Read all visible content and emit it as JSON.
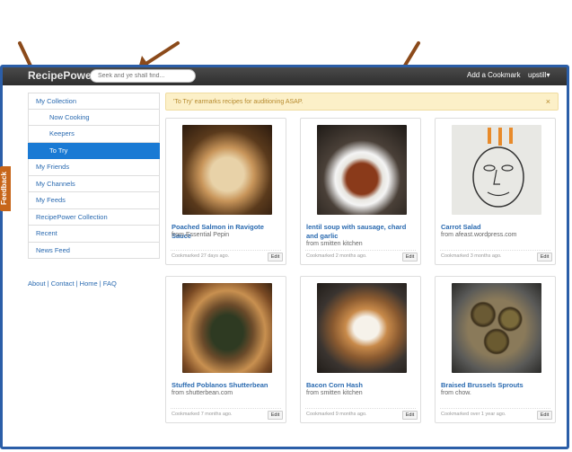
{
  "navbar": {
    "brand": "RecipePower",
    "search_placeholder": "Seek and ye shall find...",
    "add_cookmark": "Add a Cookmark",
    "user_menu": "upstill"
  },
  "feedback_tab": "Feedback",
  "sidebar": {
    "items": [
      {
        "label": "My Collection",
        "level": 0,
        "active": false
      },
      {
        "label": "Now Cooking",
        "level": 1,
        "active": false
      },
      {
        "label": "Keepers",
        "level": 1,
        "active": false
      },
      {
        "label": "To Try",
        "level": 1,
        "active": true
      },
      {
        "label": "My Friends",
        "level": 0,
        "active": false
      },
      {
        "label": "My Channels",
        "level": 0,
        "active": false
      },
      {
        "label": "My Feeds",
        "level": 0,
        "active": false
      },
      {
        "label": "RecipePower Collection",
        "level": 0,
        "active": false
      },
      {
        "label": "Recent",
        "level": 0,
        "active": false
      },
      {
        "label": "News Feed",
        "level": 0,
        "active": false
      }
    ],
    "footer_links": "About | Contact | Home | FAQ"
  },
  "alert": {
    "text": "'To Try' earmarks recipes for auditioning ASAP.",
    "close": "×"
  },
  "cards": [
    {
      "title": "Poached Salmon in Ravigote Sauce",
      "source": "from Essential Pepin",
      "meta": "Cookmarked 27 days ago.",
      "edit": "Edit"
    },
    {
      "title": "lentil soup with sausage, chard and garlic",
      "source": "from smitten kitchen",
      "meta": "Cookmarked 2 months ago.",
      "edit": "Edit"
    },
    {
      "title": "Carrot Salad",
      "source": "from afeast.wordpress.com",
      "meta": "Cookmarked 3 months ago.",
      "edit": "Edit"
    },
    {
      "title": "Stuffed Poblanos Shutterbean",
      "source": "from shutterbean.com",
      "meta": "Cookmarked 7 months ago.",
      "edit": "Edit"
    },
    {
      "title": "Bacon Corn Hash",
      "source": "from smitten kitchen",
      "meta": "Cookmarked 9 months ago.",
      "edit": "Edit"
    },
    {
      "title": "Braised Brussels Sprouts",
      "source": "from chow.",
      "meta": "Cookmarked over 1 year ago.",
      "edit": "Edit"
    }
  ],
  "colors": {
    "navbar": "#3a3a3a",
    "link": "#2a6ab0",
    "active": "#1a7ad4",
    "alert_bg": "#fcf0c8",
    "feedback": "#c7661a",
    "frame": "#2b5ea8",
    "annotation_arrow": "#8b4a1a"
  }
}
